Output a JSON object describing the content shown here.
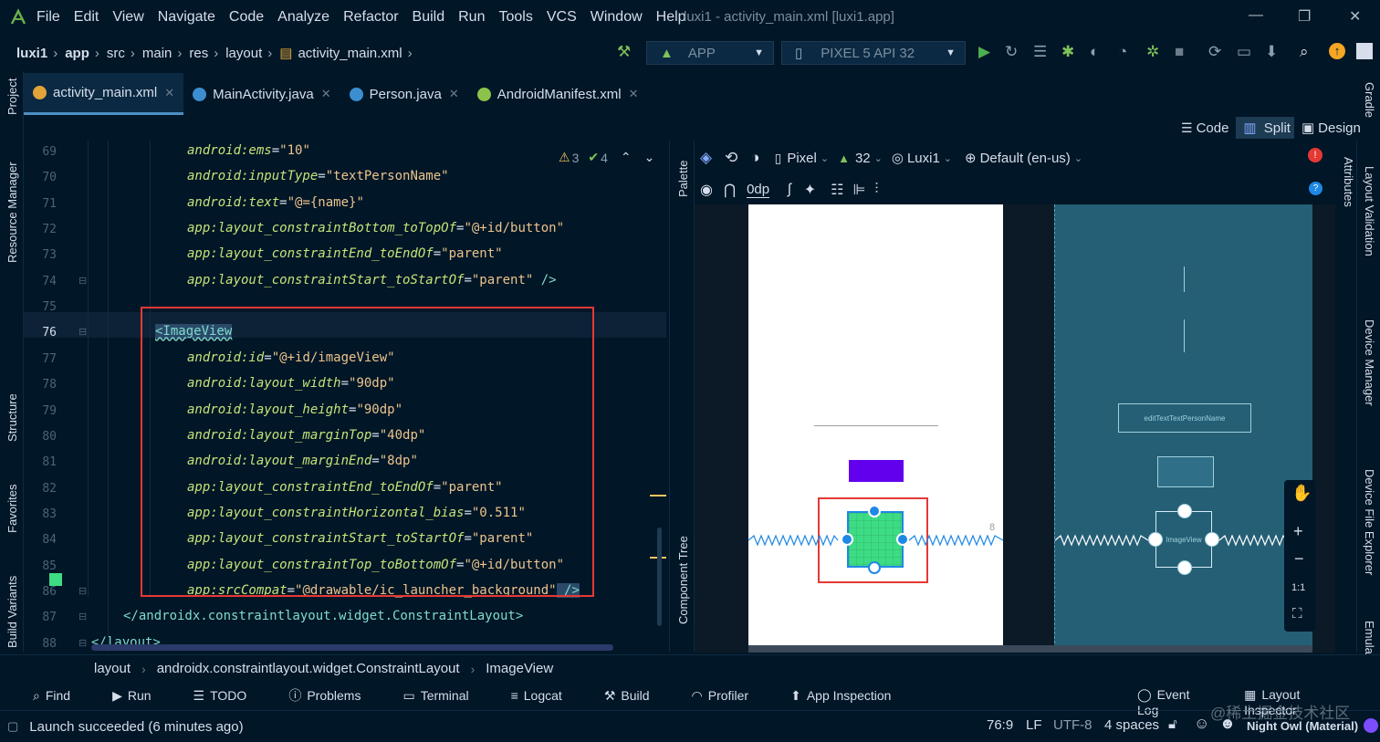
{
  "menu": [
    "File",
    "Edit",
    "View",
    "Navigate",
    "Code",
    "Analyze",
    "Refactor",
    "Build",
    "Run",
    "Tools",
    "VCS",
    "Window",
    "Help"
  ],
  "window_title": "luxi1 - activity_main.xml [luxi1.app]",
  "breadcrumbs": [
    "luxi1",
    "app",
    "src",
    "main",
    "res",
    "layout",
    "activity_main.xml"
  ],
  "toolbar": {
    "run_config": "APP",
    "device": "PIXEL 5 API 32"
  },
  "left_stripe": [
    "Project",
    "Resource Manager",
    "Structure",
    "Favorites",
    "Build Variants"
  ],
  "tabs": [
    {
      "label": "activity_main.xml",
      "color": "#e0a43a"
    },
    {
      "label": "MainActivity.java",
      "color": "#3b8fd0"
    },
    {
      "label": "Person.java",
      "color": "#3b8fd0"
    },
    {
      "label": "AndroidManifest.xml",
      "color": "#8bc34a"
    }
  ],
  "view_modes": {
    "code": "Code",
    "split": "Split",
    "design": "Design"
  },
  "inspections": {
    "warnings": "3",
    "ok": "4"
  },
  "code_lines": [
    {
      "n": "69",
      "indent": 6,
      "attr": "android:ems",
      "val": "\"10\""
    },
    {
      "n": "70",
      "indent": 6,
      "attr": "android:inputType",
      "val": "\"textPersonName\""
    },
    {
      "n": "71",
      "indent": 6,
      "attr": "android:text",
      "val": "\"@={name}\""
    },
    {
      "n": "72",
      "indent": 6,
      "attr": "app:layout_constraintBottom_toTopOf",
      "val": "\"@+id/button\""
    },
    {
      "n": "73",
      "indent": 6,
      "attr": "app:layout_constraintEnd_toEndOf",
      "val": "\"parent\""
    },
    {
      "n": "74",
      "indent": 6,
      "attr": "app:layout_constraintStart_toStartOf",
      "val": "\"parent\"",
      "tail": " />"
    },
    {
      "n": "75",
      "indent": 0,
      "attr": "",
      "val": ""
    },
    {
      "n": "76",
      "indent": 4,
      "tag": "<ImageView"
    },
    {
      "n": "77",
      "indent": 6,
      "attr": "android:id",
      "val": "\"@+id/imageView\""
    },
    {
      "n": "78",
      "indent": 6,
      "attr": "android:layout_width",
      "val": "\"90dp\""
    },
    {
      "n": "79",
      "indent": 6,
      "attr": "android:layout_height",
      "val": "\"90dp\""
    },
    {
      "n": "80",
      "indent": 6,
      "attr": "android:layout_marginTop",
      "val": "\"40dp\""
    },
    {
      "n": "81",
      "indent": 6,
      "attr": "android:layout_marginEnd",
      "val": "\"8dp\""
    },
    {
      "n": "82",
      "indent": 6,
      "attr": "app:layout_constraintEnd_toEndOf",
      "val": "\"parent\""
    },
    {
      "n": "83",
      "indent": 6,
      "attr": "app:layout_constraintHorizontal_bias",
      "val": "\"0.511\""
    },
    {
      "n": "84",
      "indent": 6,
      "attr": "app:layout_constraintStart_toStartOf",
      "val": "\"parent\""
    },
    {
      "n": "85",
      "indent": 6,
      "attr": "app:layout_constraintTop_toBottomOf",
      "val": "\"@+id/button\""
    },
    {
      "n": "86",
      "indent": 6,
      "attr": "app:srcCompat",
      "val": "\"@drawable/ic_launcher_background\"",
      "tail": " />"
    },
    {
      "n": "87",
      "indent": 2,
      "tag": "</androidx.constraintlayout.widget.ConstraintLayout>"
    },
    {
      "n": "88",
      "indent": 0,
      "tag": "</layout>"
    }
  ],
  "palette_labels": {
    "palette": "Palette",
    "component_tree": "Component Tree"
  },
  "design_toolbar": {
    "device": "Pixel",
    "api": "32",
    "theme": "Luxi1",
    "locale": "Default (en-us)",
    "margin": "0dp"
  },
  "blueprint_labels": {
    "edit_text": "editTextTextPersonName",
    "image_view": "ImageView",
    "margin_label": "8"
  },
  "zoom": {
    "fit": "1:1"
  },
  "right_stripe": [
    "Gradle",
    "Attributes",
    "Layout Validation",
    "Device Manager",
    "Device File Explorer",
    "Emulator"
  ],
  "xml_breadcrumb": [
    "layout",
    "androidx.constraintlayout.widget.ConstraintLayout",
    "ImageView"
  ],
  "tool_windows": [
    "Find",
    "Run",
    "TODO",
    "Problems",
    "Terminal",
    "Logcat",
    "Build",
    "Profiler",
    "App Inspection"
  ],
  "tool_windows_right": [
    "Event Log",
    "Layout Inspector"
  ],
  "status": {
    "message": "Launch succeeded (6 minutes ago)",
    "position": "76:9",
    "line_sep": "LF",
    "encoding": "UTF-8",
    "indent": "4 spaces",
    "theme": "Night Owl (Material)",
    "watermark": "@稀土掘金技术社区"
  }
}
